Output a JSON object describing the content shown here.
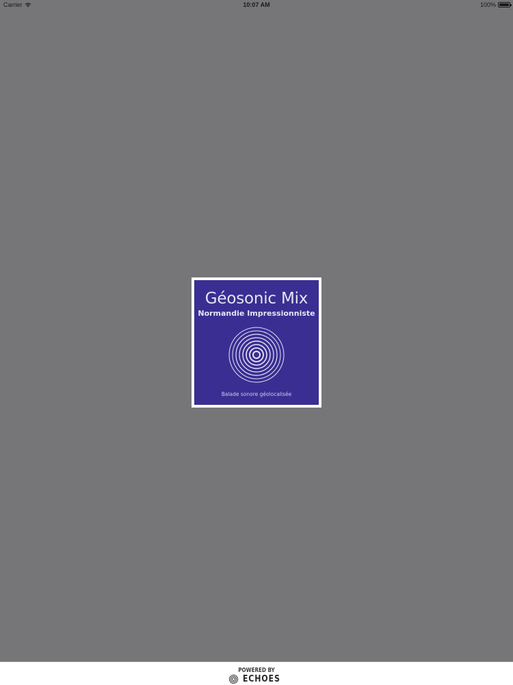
{
  "status_bar": {
    "carrier": "Carrier",
    "time": "10:07 AM",
    "battery_text": "100%",
    "battery_level": 1.0
  },
  "splash": {
    "title": "Géosonic Mix",
    "subtitle": "Normandie Impressionniste",
    "tagline": "Balade sonore géolocalisée",
    "brand_color": "#3a2e92",
    "icon": "concentric-rings-logo"
  },
  "footer": {
    "powered_by": "POWERED BY",
    "brand": "ECHOES"
  },
  "colors": {
    "background": "#767577",
    "card_border": "#ffffff",
    "footer_bg": "#ffffff"
  }
}
